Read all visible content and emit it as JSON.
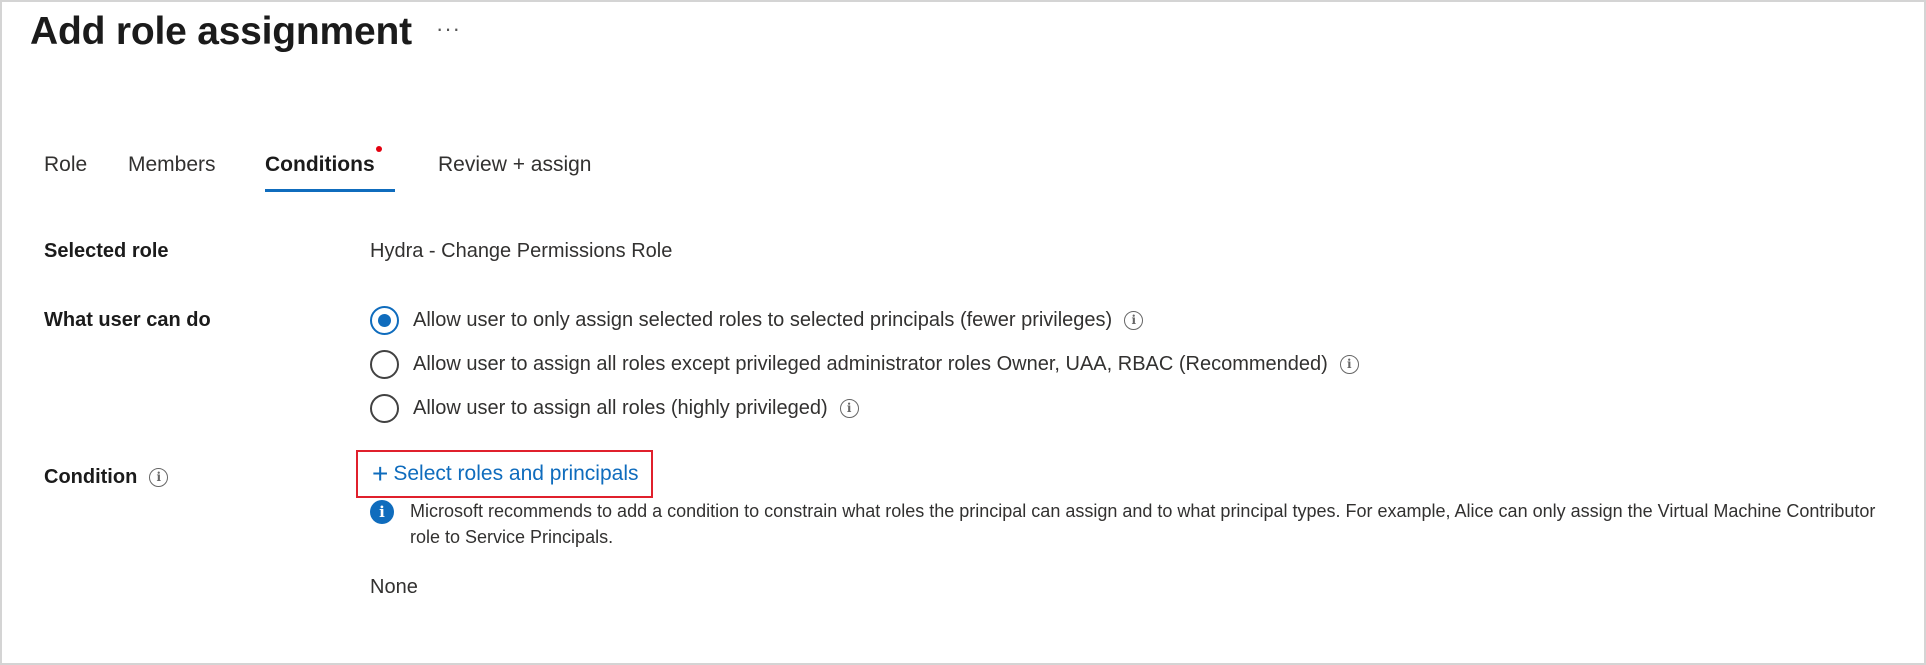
{
  "page": {
    "title": "Add role assignment",
    "more_label": "···"
  },
  "tabs": [
    {
      "label": "Role",
      "active": false
    },
    {
      "label": "Members",
      "active": false
    },
    {
      "label": "Conditions",
      "active": true,
      "required": true
    },
    {
      "label": "Review + assign",
      "active": false
    }
  ],
  "selected_role": {
    "label": "Selected role",
    "value": "Hydra - Change Permissions Role"
  },
  "what_user_can_do": {
    "label": "What user can do",
    "options": [
      {
        "label": "Allow user to only assign selected roles to selected principals (fewer privileges)",
        "checked": true
      },
      {
        "label": "Allow user to assign all roles except privileged administrator roles Owner, UAA, RBAC (Recommended)",
        "checked": false
      },
      {
        "label": "Allow user to assign all roles (highly privileged)",
        "checked": false
      }
    ]
  },
  "condition": {
    "label": "Condition",
    "add_link": "Select roles and principals",
    "add_icon": "+",
    "info_text": "Microsoft recommends to add a condition to constrain what roles the principal can assign and to what principal types. For example, Alice can only assign the Virtual Machine Contributor role to Service Principals.",
    "value": "None"
  },
  "colors": {
    "accent": "#0f6cbd",
    "highlight_box": "#e0202c",
    "required_dot": "#e3000f"
  }
}
